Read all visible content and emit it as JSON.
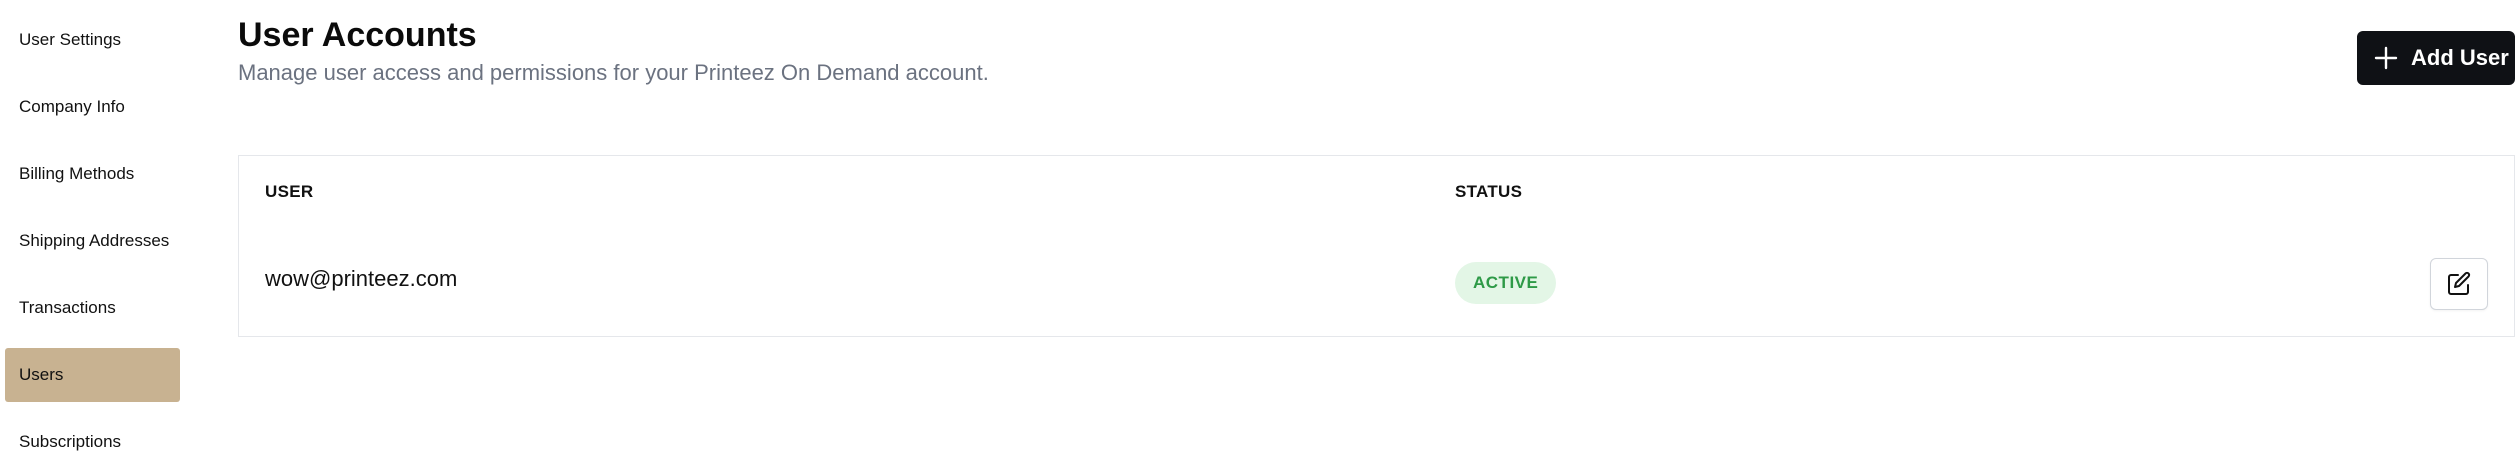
{
  "sidebar": {
    "items": [
      {
        "label": "User Settings",
        "active": false
      },
      {
        "label": "Company Info",
        "active": false
      },
      {
        "label": "Billing Methods",
        "active": false
      },
      {
        "label": "Shipping Addresses",
        "active": false
      },
      {
        "label": "Transactions",
        "active": false
      },
      {
        "label": "Users",
        "active": true
      },
      {
        "label": "Subscriptions",
        "active": false
      }
    ],
    "active_color": "#c8b291"
  },
  "header": {
    "title": "User Accounts",
    "subtitle": "Manage user access and permissions for your Printeez On Demand account.",
    "add_user_label": "Add User",
    "add_user_icon": "plus-icon"
  },
  "table": {
    "columns": [
      "USER",
      "STATUS"
    ],
    "rows": [
      {
        "email": "wow@printeez.com",
        "status": "ACTIVE",
        "action_icon": "edit-icon"
      }
    ]
  },
  "colors": {
    "primary_button": "#0f1115",
    "status_active_bg": "#e3f6e6",
    "status_active_text": "#2e9a47",
    "subtitle_text": "#6b7280"
  }
}
